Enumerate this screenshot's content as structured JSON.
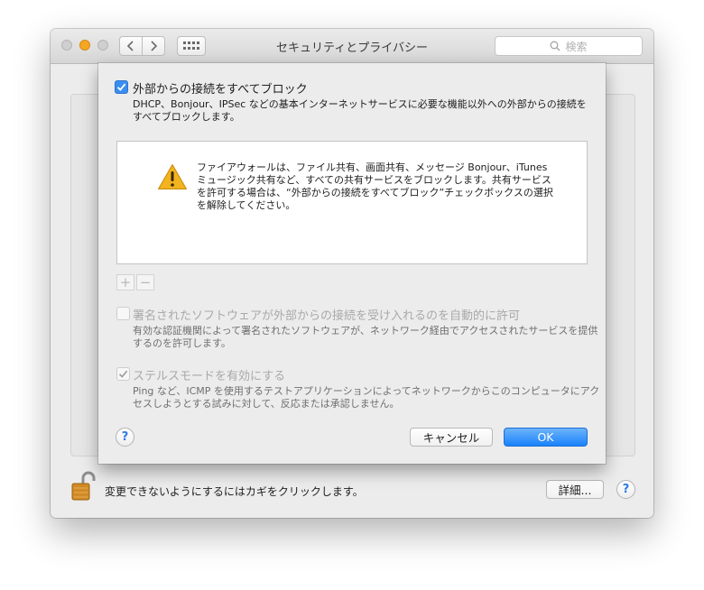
{
  "window": {
    "title": "セキュリティとプライバシー",
    "search_placeholder": "検索"
  },
  "sheet": {
    "block_all": {
      "label": "外部からの接続をすべてブロック",
      "checked": true,
      "description": "DHCP、Bonjour、IPSec などの基本インターネットサービスに必要な機能以外への外部からの接続をすべてブロックします。"
    },
    "warning_text": "ファイアウォールは、ファイル共有、画面共有、メッセージ Bonjour、iTunes ミュージック共有など、すべての共有サービスをブロックします。共有サービスを許可する場合は、“外部からの接続をすべてブロック”チェックボックスの選択を解除してください。",
    "add_label": "+",
    "remove_label": "−",
    "signed_software": {
      "label": "署名されたソフトウェアが外部からの接続を受け入れるのを自動的に許可",
      "checked": false,
      "enabled": false,
      "description": "有効な認証機関によって署名されたソフトウェアが、ネットワーク経由でアクセスされたサービスを提供するのを許可します。"
    },
    "stealth_mode": {
      "label": "ステルスモードを有効にする",
      "checked": true,
      "enabled": false,
      "description": "Ping など、ICMP を使用するテストアプリケーションによってネットワークからこのコンピュータにアクセスしようとする試みに対して、反応または承認しません。"
    },
    "help_label": "?",
    "cancel_label": "キャンセル",
    "ok_label": "OK"
  },
  "footer": {
    "lock_text": "変更できないようにするにはカギをクリックします。",
    "details_label": "詳細...",
    "help_label": "?"
  },
  "colors": {
    "accent": "#1a82fb",
    "lock": "#d08a26",
    "warning": "#f2b31e"
  }
}
